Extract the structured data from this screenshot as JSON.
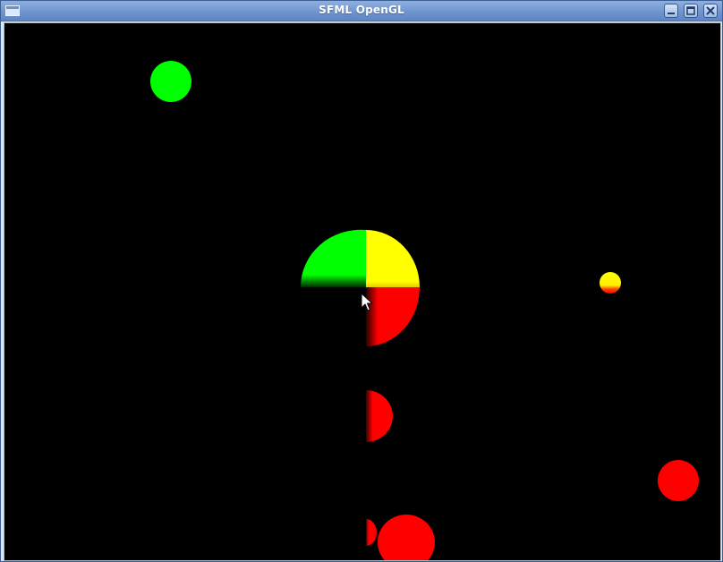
{
  "window": {
    "title": "SFML OpenGL",
    "title_icon": "window-icon",
    "buttons": {
      "minimize": "minimize-icon",
      "maximize": "maximize-icon",
      "close": "close-icon"
    }
  },
  "scene": {
    "background": "#000000",
    "colors": {
      "green": "#00ff00",
      "yellow": "#ffff00",
      "red": "#ff0000"
    },
    "cursor": "mouse-pointer-icon"
  }
}
